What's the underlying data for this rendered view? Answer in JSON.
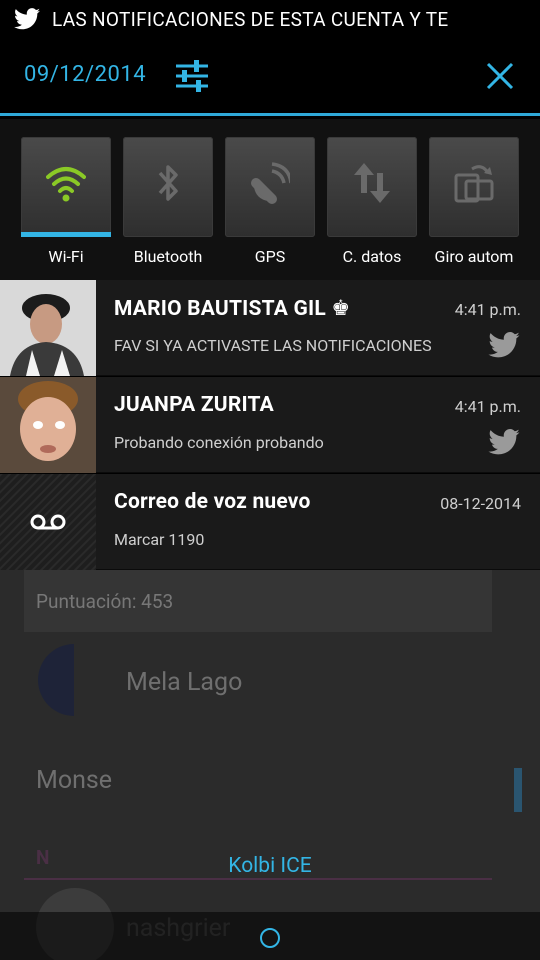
{
  "ticker": {
    "icon": "twitter-bird-icon",
    "text": "LAS NOTIFICACIONES DE ESTA CUENTA Y TE"
  },
  "header": {
    "date": "09/12/2014",
    "settings_icon": "settings-sliders-icon",
    "close_icon": "close-icon"
  },
  "toggles": [
    {
      "label": "Wi-Fi",
      "icon": "wifi-icon",
      "active": true
    },
    {
      "label": "Bluetooth",
      "icon": "bluetooth-icon",
      "active": false
    },
    {
      "label": "GPS",
      "icon": "gps-icon",
      "active": false
    },
    {
      "label": "C. datos",
      "icon": "data-arrows-icon",
      "active": false
    },
    {
      "label": "Giro autom",
      "icon": "auto-rotate-icon",
      "active": false
    }
  ],
  "notifications": [
    {
      "title": "MARIO BAUTISTA GIL ♚",
      "time": "4:41 p.m.",
      "body": "FAV SI YA ACTIVASTE LAS NOTIFICACIONES",
      "app_icon": "twitter-bird-icon"
    },
    {
      "title": "JUANPA ZURITA",
      "time": "4:41 p.m.",
      "body": "Probando conexión probando",
      "app_icon": "twitter-bird-icon"
    },
    {
      "title": "Correo de voz nuevo",
      "time": "08-12-2014",
      "body": "Marcar 1190",
      "app_icon": "voicemail-icon"
    }
  ],
  "background_app": {
    "score": "Puntuación: 453",
    "contact1": "Mela Lago",
    "contact2": "Monse",
    "section": "N",
    "contact3": "nashgrier"
  },
  "carrier": "Kolbi ICE",
  "colors": {
    "accent": "#33b5e5",
    "wifi_active": "#8ac926"
  }
}
